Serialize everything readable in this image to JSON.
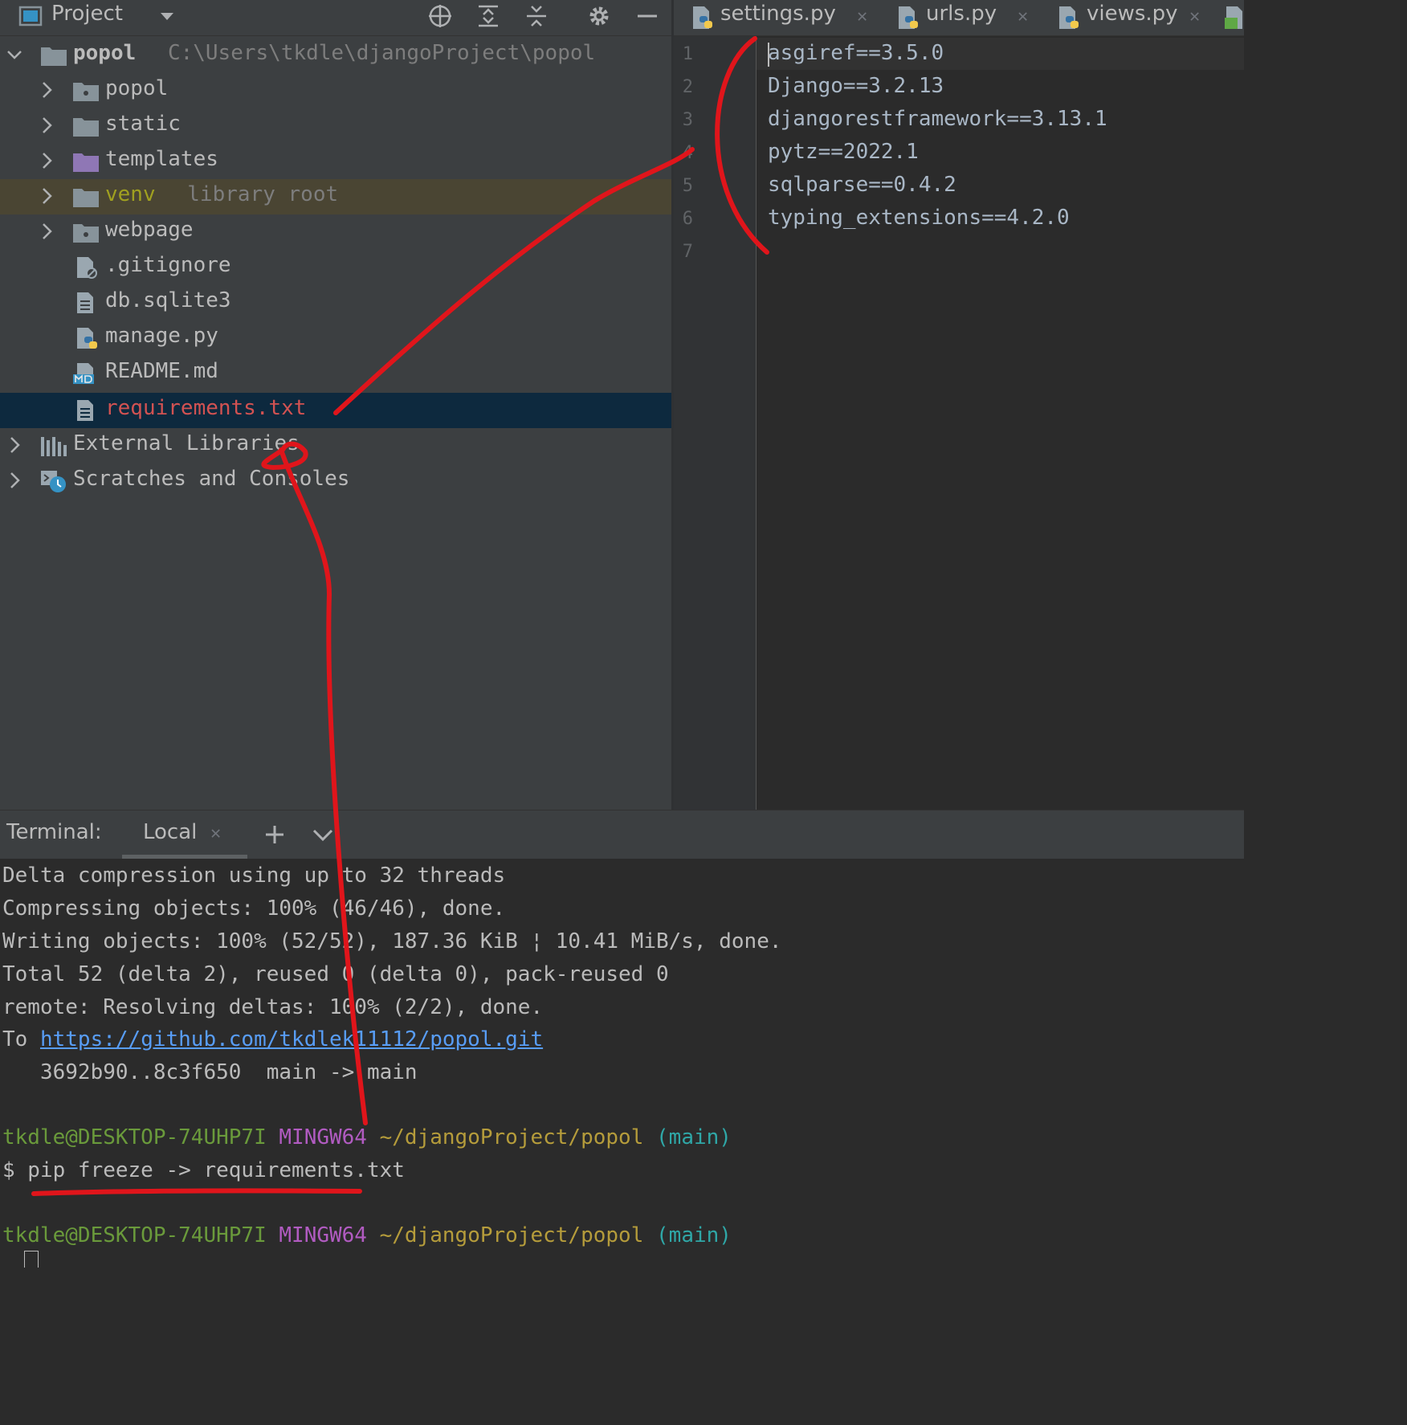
{
  "project_header": {
    "title": "Project"
  },
  "tree": {
    "root": {
      "name": "popol",
      "path": "C:\\Users\\tkdle\\djangoProject\\popol"
    },
    "items": [
      {
        "label": "popol",
        "type": "folder"
      },
      {
        "label": "static",
        "type": "folder"
      },
      {
        "label": "templates",
        "type": "folder-purple"
      },
      {
        "label": "venv",
        "hint": "library root",
        "type": "folder"
      },
      {
        "label": "webpage",
        "type": "folder"
      },
      {
        "label": ".gitignore",
        "type": "file-ignore"
      },
      {
        "label": "db.sqlite3",
        "type": "file"
      },
      {
        "label": "manage.py",
        "type": "file-python"
      },
      {
        "label": "README.md",
        "type": "file-md"
      },
      {
        "label": "requirements.txt",
        "type": "file"
      }
    ],
    "external_libraries": "External Libraries",
    "scratches": "Scratches and Consoles"
  },
  "editor": {
    "tabs": [
      {
        "label": "settings.py"
      },
      {
        "label": "urls.py"
      },
      {
        "label": "views.py"
      }
    ],
    "line_numbers": [
      "1",
      "2",
      "3",
      "4",
      "5",
      "6",
      "7"
    ],
    "lines": [
      "asgiref==3.5.0",
      "Django==3.2.13",
      "djangorestframework==3.13.1",
      "pytz==2022.1",
      "sqlparse==0.4.2",
      "typing_extensions==4.2.0",
      ""
    ]
  },
  "terminal": {
    "title": "Terminal:",
    "tab_label": "Local",
    "output": [
      "Delta compression using up to 32 threads",
      "Compressing objects: 100% (46/46), done.",
      "Writing objects: 100% (52/52), 187.36 KiB ¦ 10.41 MiB/s, done.",
      "Total 52 (delta 2), reused 0 (delta 0), pack-reused 0",
      "remote: Resolving deltas: 100% (2/2), done."
    ],
    "push_to_prefix": "To ",
    "push_url": "https://github.com/tkdlek11112/popol.git",
    "push_refs": "   3692b90..8c3f650  main -> main",
    "prompt1": {
      "user": "tkdle@DESKTOP-74UHP7I",
      "system": "MINGW64",
      "path": "~/djangoProject/popol",
      "branch": "(main)"
    },
    "command": "$ pip freeze -> requirements.txt",
    "prompt2": {
      "user": "tkdle@DESKTOP-74UHP7I",
      "system": "MINGW64",
      "path": "~/djangoProject/popol",
      "branch": "(main)"
    }
  },
  "colors": {
    "annotation": "#e0151b",
    "selected_row": "#0d293e",
    "library_root_row": "#4a4533",
    "folder_purple": "#8f77b5",
    "venv_text": "#a0a020",
    "requirements_text": "#d25252"
  }
}
